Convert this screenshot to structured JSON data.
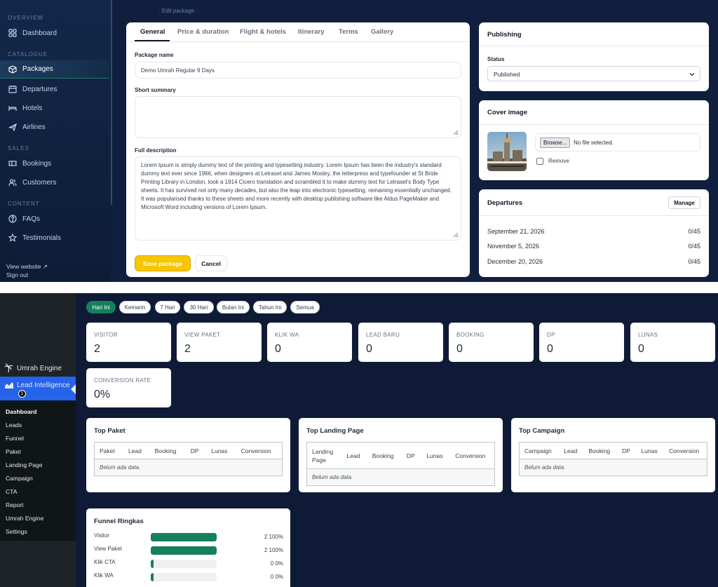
{
  "admin": {
    "sidebar": {
      "sections": [
        {
          "title": "OVERVIEW",
          "items": [
            {
              "label": "Dashboard",
              "icon": "dashboard-icon"
            }
          ]
        },
        {
          "title": "CATALOGUE",
          "items": [
            {
              "label": "Packages",
              "icon": "package-icon",
              "active": true
            },
            {
              "label": "Departures",
              "icon": "calendar-icon"
            },
            {
              "label": "Hotels",
              "icon": "bed-icon"
            },
            {
              "label": "Airlines",
              "icon": "plane-icon"
            }
          ]
        },
        {
          "title": "SALES",
          "items": [
            {
              "label": "Bookings",
              "icon": "ticket-icon"
            },
            {
              "label": "Customers",
              "icon": "users-icon"
            }
          ]
        },
        {
          "title": "CONTENT",
          "items": [
            {
              "label": "FAQs",
              "icon": "help-icon"
            },
            {
              "label": "Testimonials",
              "icon": "star-icon"
            }
          ]
        }
      ],
      "view_website": "View website ↗",
      "sign_out": "Sign out"
    },
    "breadcrumb": "· Edit package ·",
    "tabs": [
      "General",
      "Price & duration",
      "Flight & hotels",
      "Itinerary",
      "Terms",
      "Gallery"
    ],
    "form": {
      "package_name_label": "Package name",
      "package_name_value": "Demo Umrah Regular 9 Days",
      "short_summary_label": "Short summary",
      "short_summary_value": "",
      "full_description_label": "Full description",
      "full_description_value": "Lorem Ipsum is simply dummy text of the printing and typesetting industry. Lorem Ipsum has been the industry's standard dummy text ever since 1966, when designers at Letraset and James Mosley, the letterpress and typefounder at St Bride Printing Library in London, took a 1914 Cicero translation and scrambled it to make dummy text for Letraset's Body Type sheets. It has survived not only many decades, but also the leap into electronic typesetting, remaining essentially unchanged. It was popularised thanks to these sheets and more recently with desktop publishing software like Aldus PageMaker and Microsoft Word including versions of Lorem Ipsum.",
      "save_label": "Save package",
      "cancel_label": "Cancel"
    },
    "publishing": {
      "title": "Publishing",
      "status_label": "Status",
      "status_value": "Published"
    },
    "cover": {
      "title": "Cover image",
      "browse_label": "Browse...",
      "file_status": "No file selected.",
      "remove_label": "Remove"
    },
    "departures": {
      "title": "Departures",
      "manage_label": "Manage",
      "rows": [
        {
          "date": "September 21, 2026",
          "count": "0/45"
        },
        {
          "date": "November 5, 2026",
          "count": "0/45"
        },
        {
          "date": "December 20, 2026",
          "count": "0/45"
        }
      ]
    }
  },
  "wp": {
    "menu": {
      "umrah_engine": "Umrah Engine",
      "lead_intelligence": "Lead Intelligence",
      "badge": "1",
      "submenu": [
        "Dashboard",
        "Leads",
        "Funnel",
        "Paket",
        "Landing Page",
        "Campaign",
        "CTA",
        "Report",
        "Umrah Engine",
        "Settings"
      ]
    },
    "filters": [
      {
        "label": "Hari Ini",
        "active": true
      },
      {
        "label": "Kemarin"
      },
      {
        "label": "7 Hari"
      },
      {
        "label": "30 Hari"
      },
      {
        "label": "Bulan Ini"
      },
      {
        "label": "Tahun Ini"
      },
      {
        "label": "Semua"
      }
    ],
    "stats": [
      {
        "label": "VISITOR",
        "value": "2"
      },
      {
        "label": "VIEW PAKET",
        "value": "2"
      },
      {
        "label": "KLIK WA",
        "value": "0"
      },
      {
        "label": "LEAD BARU",
        "value": "0"
      },
      {
        "label": "BOOKING",
        "value": "0"
      },
      {
        "label": "DP",
        "value": "0"
      },
      {
        "label": "LUNAS",
        "value": "0"
      },
      {
        "label": "CONVERSION RATE",
        "value": "0%"
      }
    ],
    "tables": [
      {
        "title": "Top Paket",
        "first_col": "Paket",
        "columns": [
          "Lead",
          "Booking",
          "DP",
          "Lunas",
          "Conversion"
        ],
        "empty": "Belum ada data."
      },
      {
        "title": "Top Landing Page",
        "first_col": "Landing Page",
        "columns": [
          "Lead",
          "Booking",
          "DP",
          "Lunas",
          "Conversion"
        ],
        "empty": "Belum ada data."
      },
      {
        "title": "Top Campaign",
        "first_col": "Campaign",
        "columns": [
          "Lead",
          "Booking",
          "DP",
          "Lunas",
          "Conversion"
        ],
        "empty": "Belum ada data."
      }
    ],
    "funnel": {
      "title": "Funnel Ringkas",
      "rows": [
        {
          "label": "Visitor",
          "count": "2",
          "pct": "100%",
          "fill": 1.0
        },
        {
          "label": "View Paket",
          "count": "2",
          "pct": "100%",
          "fill": 1.0
        },
        {
          "label": "Klik CTA",
          "count": "0",
          "pct": "0%",
          "fill": 0.0
        },
        {
          "label": "Klik WA",
          "count": "0",
          "pct": "0%",
          "fill": 0.0
        }
      ]
    }
  }
}
